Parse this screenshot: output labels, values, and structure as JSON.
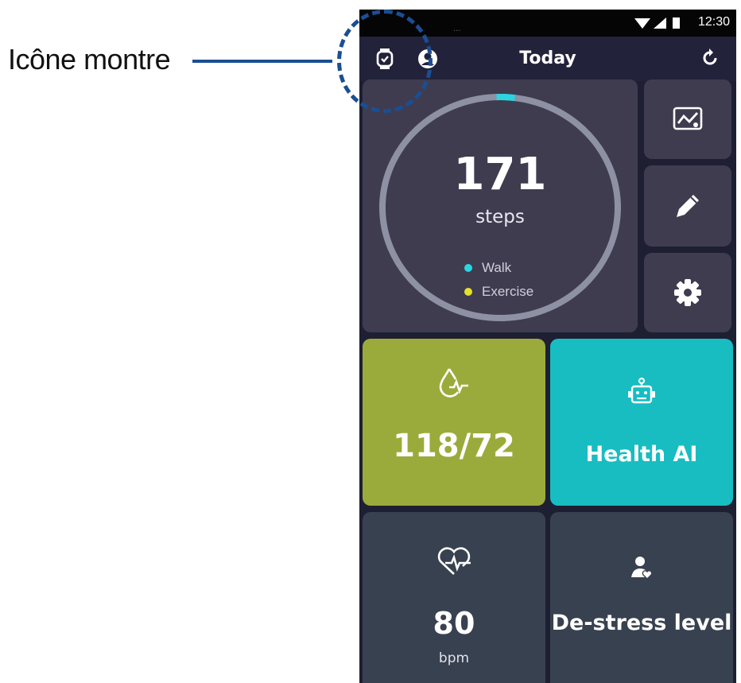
{
  "callout": {
    "label": "Icône montre"
  },
  "status_bar": {
    "time": "12:30"
  },
  "app_bar": {
    "title": "Today",
    "icons": [
      "watch-icon",
      "profile-icon",
      "refresh-icon"
    ]
  },
  "steps": {
    "value": "171",
    "unit": "steps",
    "progress": 0.02,
    "legend": [
      {
        "label": "Walk",
        "color": "#2bd5e0"
      },
      {
        "label": "Exercise",
        "color": "#e3e12a"
      }
    ]
  },
  "side_buttons": [
    "trends-icon",
    "edit-icon",
    "settings-icon"
  ],
  "blood_pressure": {
    "value": "118/72",
    "icon": "blood-pressure-icon"
  },
  "health_ai": {
    "label": "Health AI",
    "icon": "robot-icon"
  },
  "heart_rate": {
    "value": "80",
    "unit": "bpm",
    "icon": "heart-rate-icon"
  },
  "destress": {
    "label": "De-stress level",
    "icon": "person-heart-icon"
  },
  "colors": {
    "background": "#1e1f33",
    "tile": "#3f3c50",
    "blood_pressure_tile": "#9bab3b",
    "health_ai_tile": "#18bdc1",
    "dark_tile": "#38414f",
    "callout_blue": "#1b4e93"
  }
}
